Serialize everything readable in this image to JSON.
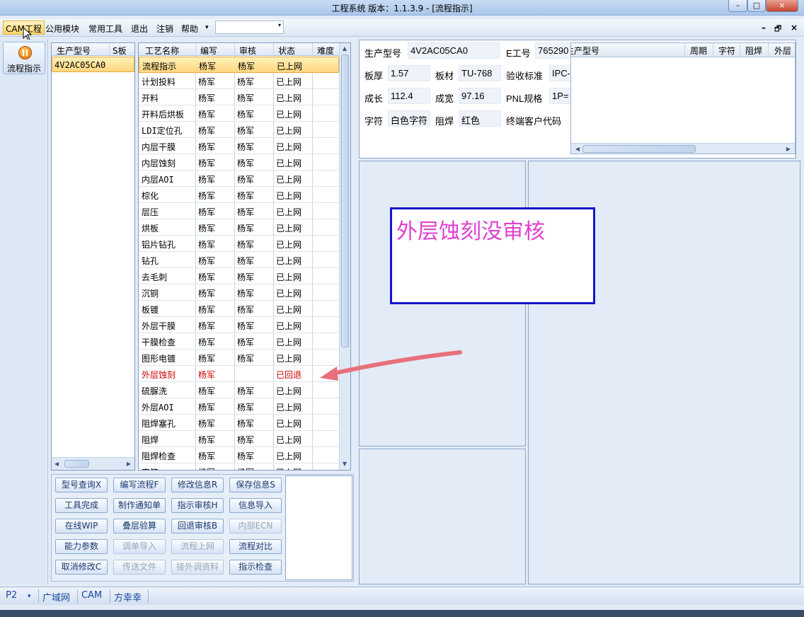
{
  "window": {
    "title": "工程系统   版本：1.1.3.9 - [流程指示]",
    "min": "–",
    "max": "□",
    "close": "×"
  },
  "menubar": {
    "items": [
      "CAM工程",
      "公用模块",
      "常用工具",
      "退出",
      "注销",
      "帮助"
    ],
    "dropdown_arrow": "▾",
    "combo_value": "",
    "mdi_controls": [
      "–",
      "🗗",
      "×"
    ]
  },
  "leftbar": {
    "flow_label": "流程指示"
  },
  "part_list": {
    "headers": [
      "生产型号",
      "S板"
    ],
    "rows": [
      {
        "model": "4V2AC05CA0",
        "s": ""
      }
    ]
  },
  "process_table": {
    "headers": [
      "工艺名称",
      "编写",
      "审核",
      "状态",
      "难度"
    ],
    "rows": [
      {
        "name": "流程指示",
        "writer": "杨军",
        "reviewer": "杨军",
        "status": "已上网"
      },
      {
        "name": "计划投料",
        "writer": "杨军",
        "reviewer": "杨军",
        "status": "已上网"
      },
      {
        "name": "开料",
        "writer": "杨军",
        "reviewer": "杨军",
        "status": "已上网"
      },
      {
        "name": "开料后烘板",
        "writer": "杨军",
        "reviewer": "杨军",
        "status": "已上网"
      },
      {
        "name": "LDI定位孔",
        "writer": "杨军",
        "reviewer": "杨军",
        "status": "已上网"
      },
      {
        "name": "内层干膜",
        "writer": "杨军",
        "reviewer": "杨军",
        "status": "已上网"
      },
      {
        "name": "内层蚀刻",
        "writer": "杨军",
        "reviewer": "杨军",
        "status": "已上网"
      },
      {
        "name": "内层AOI",
        "writer": "杨军",
        "reviewer": "杨军",
        "status": "已上网"
      },
      {
        "name": "棕化",
        "writer": "杨军",
        "reviewer": "杨军",
        "status": "已上网"
      },
      {
        "name": "层压",
        "writer": "杨军",
        "reviewer": "杨军",
        "status": "已上网"
      },
      {
        "name": "烘板",
        "writer": "杨军",
        "reviewer": "杨军",
        "status": "已上网"
      },
      {
        "name": "铝片钻孔",
        "writer": "杨军",
        "reviewer": "杨军",
        "status": "已上网"
      },
      {
        "name": "钻孔",
        "writer": "杨军",
        "reviewer": "杨军",
        "status": "已上网"
      },
      {
        "name": "去毛刺",
        "writer": "杨军",
        "reviewer": "杨军",
        "status": "已上网"
      },
      {
        "name": "沉铜",
        "writer": "杨军",
        "reviewer": "杨军",
        "status": "已上网"
      },
      {
        "name": "板镀",
        "writer": "杨军",
        "reviewer": "杨军",
        "status": "已上网"
      },
      {
        "name": "外层干膜",
        "writer": "杨军",
        "reviewer": "杨军",
        "status": "已上网"
      },
      {
        "name": "干膜检查",
        "writer": "杨军",
        "reviewer": "杨军",
        "status": "已上网"
      },
      {
        "name": "图形电镀",
        "writer": "杨军",
        "reviewer": "杨军",
        "status": "已上网"
      },
      {
        "name": "外层蚀刻",
        "writer": "杨军",
        "reviewer": "",
        "status": "已回退"
      },
      {
        "name": "硫脲洗",
        "writer": "杨军",
        "reviewer": "杨军",
        "status": "已上网"
      },
      {
        "name": "外层AOI",
        "writer": "杨军",
        "reviewer": "杨军",
        "status": "已上网"
      },
      {
        "name": "阻焊塞孔",
        "writer": "杨军",
        "reviewer": "杨军",
        "status": "已上网"
      },
      {
        "name": "阻焊",
        "writer": "杨军",
        "reviewer": "杨军",
        "status": "已上网"
      },
      {
        "name": "阻焊检查",
        "writer": "杨军",
        "reviewer": "杨军",
        "status": "已上网"
      },
      {
        "name": "字符",
        "writer": "杨军",
        "reviewer": "杨军",
        "status": "已上网"
      }
    ]
  },
  "buttons": [
    [
      {
        "label": "型号查询X",
        "enabled": true
      },
      {
        "label": "编写流程F",
        "enabled": true
      },
      {
        "label": "修改信息R",
        "enabled": true
      },
      {
        "label": "保存信息S",
        "enabled": true
      }
    ],
    [
      {
        "label": "工具完成",
        "enabled": true
      },
      {
        "label": "制作通知单",
        "enabled": true
      },
      {
        "label": "指示审核H",
        "enabled": true
      },
      {
        "label": "信息导入",
        "enabled": true
      }
    ],
    [
      {
        "label": "在线WIP",
        "enabled": true
      },
      {
        "label": "叠层验算",
        "enabled": true
      },
      {
        "label": "回退审核B",
        "enabled": true
      },
      {
        "label": "内部ECN",
        "enabled": false
      }
    ],
    [
      {
        "label": "能力参数",
        "enabled": true
      },
      {
        "label": "调单导入",
        "enabled": false
      },
      {
        "label": "流程上网",
        "enabled": false
      },
      {
        "label": "流程对比",
        "enabled": true
      }
    ],
    [
      {
        "label": "取消修改C",
        "enabled": true
      },
      {
        "label": "传送文件",
        "enabled": false
      },
      {
        "label": "接外调资料",
        "enabled": false
      },
      {
        "label": "指示检查",
        "enabled": true
      }
    ]
  ],
  "info": {
    "model_label": "生产型号",
    "model_value": "4V2AC05CA0",
    "e_label": "E工号",
    "e_value": "765290",
    "thick_label": "板厚",
    "thick_value": "1.57",
    "material_label": "板材",
    "material_value": "TU-768",
    "accept_label": "验收标准",
    "accept_value": "IPC-",
    "len_label": "成长",
    "len_value": "112.4",
    "width_label": "成宽",
    "width_value": "97.16",
    "pnl_label": "PNL规格",
    "pnl_value": "1P=",
    "char_label": "字符",
    "char_value": "白色字符",
    "mask_label": "阻焊",
    "mask_value": "红色",
    "cust_label": "终端客户代码"
  },
  "right_grid": {
    "headers": [
      "生产型号",
      "周期",
      "字符",
      "阻焊",
      "外层"
    ]
  },
  "annotation": {
    "text": "外层蚀刻没审核",
    "arrow_color": "#e8707a",
    "box_color": "#1515c8",
    "text_color": "#e040d0"
  },
  "statusbar": {
    "page": "P2",
    "dropdown": "▾",
    "items": [
      "广域网",
      "CAM",
      "方幸幸"
    ]
  }
}
